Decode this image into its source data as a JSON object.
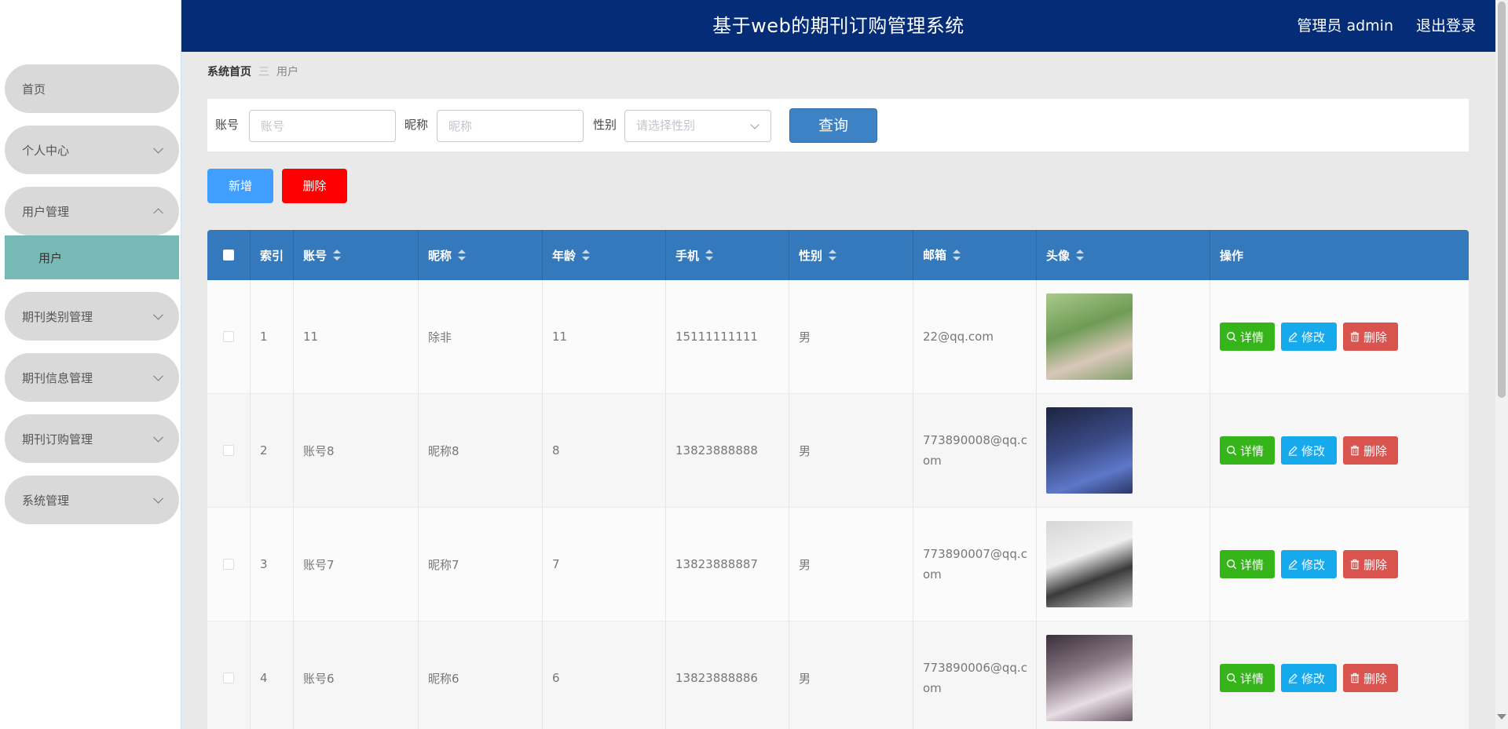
{
  "header": {
    "title": "基于web的期刊订购管理系统",
    "user": "管理员 admin",
    "logout": "退出登录"
  },
  "sidebar": {
    "items": [
      {
        "label": "首页"
      },
      {
        "label": "个人中心"
      },
      {
        "label": "用户管理"
      },
      {
        "label": "期刊类别管理"
      },
      {
        "label": "期刊信息管理"
      },
      {
        "label": "期刊订购管理"
      },
      {
        "label": "系统管理"
      }
    ],
    "submenu": {
      "label": "用户"
    }
  },
  "breadcrumb": {
    "home": "系统首页",
    "separator": "三",
    "current": "用户"
  },
  "search": {
    "account_label": "账号",
    "account_placeholder": "账号",
    "nickname_label": "昵称",
    "nickname_placeholder": "昵称",
    "gender_label": "性别",
    "gender_placeholder": "请选择性别",
    "query_label": "查询"
  },
  "actions": {
    "add_label": "新增",
    "delete_label": "删除"
  },
  "table": {
    "headers": [
      "索引",
      "账号",
      "昵称",
      "年龄",
      "手机",
      "性别",
      "邮箱",
      "头像",
      "操作"
    ],
    "op_labels": {
      "detail": "详情",
      "edit": "修改",
      "delete": "删除"
    },
    "rows": [
      {
        "index": "1",
        "account": "11",
        "nickname": "除非",
        "age": "11",
        "phone": "15111111111",
        "gender": "男",
        "email": "22@qq.com"
      },
      {
        "index": "2",
        "account": "账号8",
        "nickname": "昵称8",
        "age": "8",
        "phone": "13823888888",
        "gender": "男",
        "email": "773890008@qq.com"
      },
      {
        "index": "3",
        "account": "账号7",
        "nickname": "昵称7",
        "age": "7",
        "phone": "13823888887",
        "gender": "男",
        "email": "773890007@qq.com"
      },
      {
        "index": "4",
        "account": "账号6",
        "nickname": "昵称6",
        "age": "6",
        "phone": "13823888886",
        "gender": "男",
        "email": "773890006@qq.com"
      }
    ]
  },
  "colors": {
    "header_bg": "#052c77",
    "table_head": "#3579bd",
    "submenu_active": "#76b9b5",
    "detail": "#35b51a",
    "edit": "#16a9ec",
    "delete": "#d9534f",
    "add": "#409eff",
    "remove": "#ff0000"
  }
}
